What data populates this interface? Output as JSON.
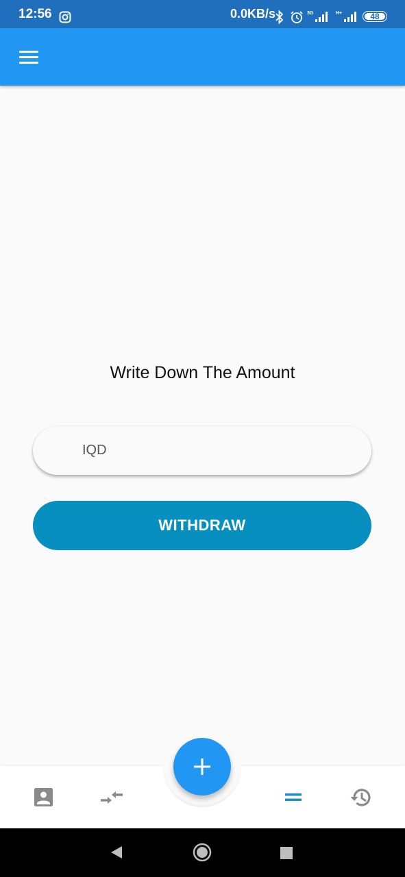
{
  "status_bar": {
    "time": "12:56",
    "net_speed": "0.0KB/s",
    "sig1_type": "3G",
    "sig2_type": "H+",
    "battery": "48",
    "icons": [
      "instagram-icon",
      "bluetooth-icon",
      "alarm-icon",
      "signal-3g-icon",
      "signal-hplus-icon",
      "battery-icon"
    ]
  },
  "app_bar": {
    "menu_icon": "hamburger-menu-icon"
  },
  "main": {
    "prompt": "Write Down The Amount",
    "amount_placeholder": "IQD",
    "amount_value": "",
    "withdraw_label": "WITHDRAW"
  },
  "bottom_nav": {
    "items": [
      {
        "icon": "account-box-icon",
        "active": false
      },
      {
        "icon": "transfer-arrows-icon",
        "active": false
      },
      {
        "icon": "equals-icon",
        "active": true
      },
      {
        "icon": "history-icon",
        "active": false
      }
    ],
    "fab_icon": "plus-icon"
  },
  "system_nav": {
    "icons": [
      "back-icon",
      "home-icon",
      "recents-icon"
    ]
  },
  "colors": {
    "status_bar": "#1f6fbd",
    "app_bar": "#2196f3",
    "accent_button": "#078fbf",
    "fab": "#2196f3",
    "inactive_icon": "#8a8a8a",
    "active_icon": "#1a8fc7"
  }
}
